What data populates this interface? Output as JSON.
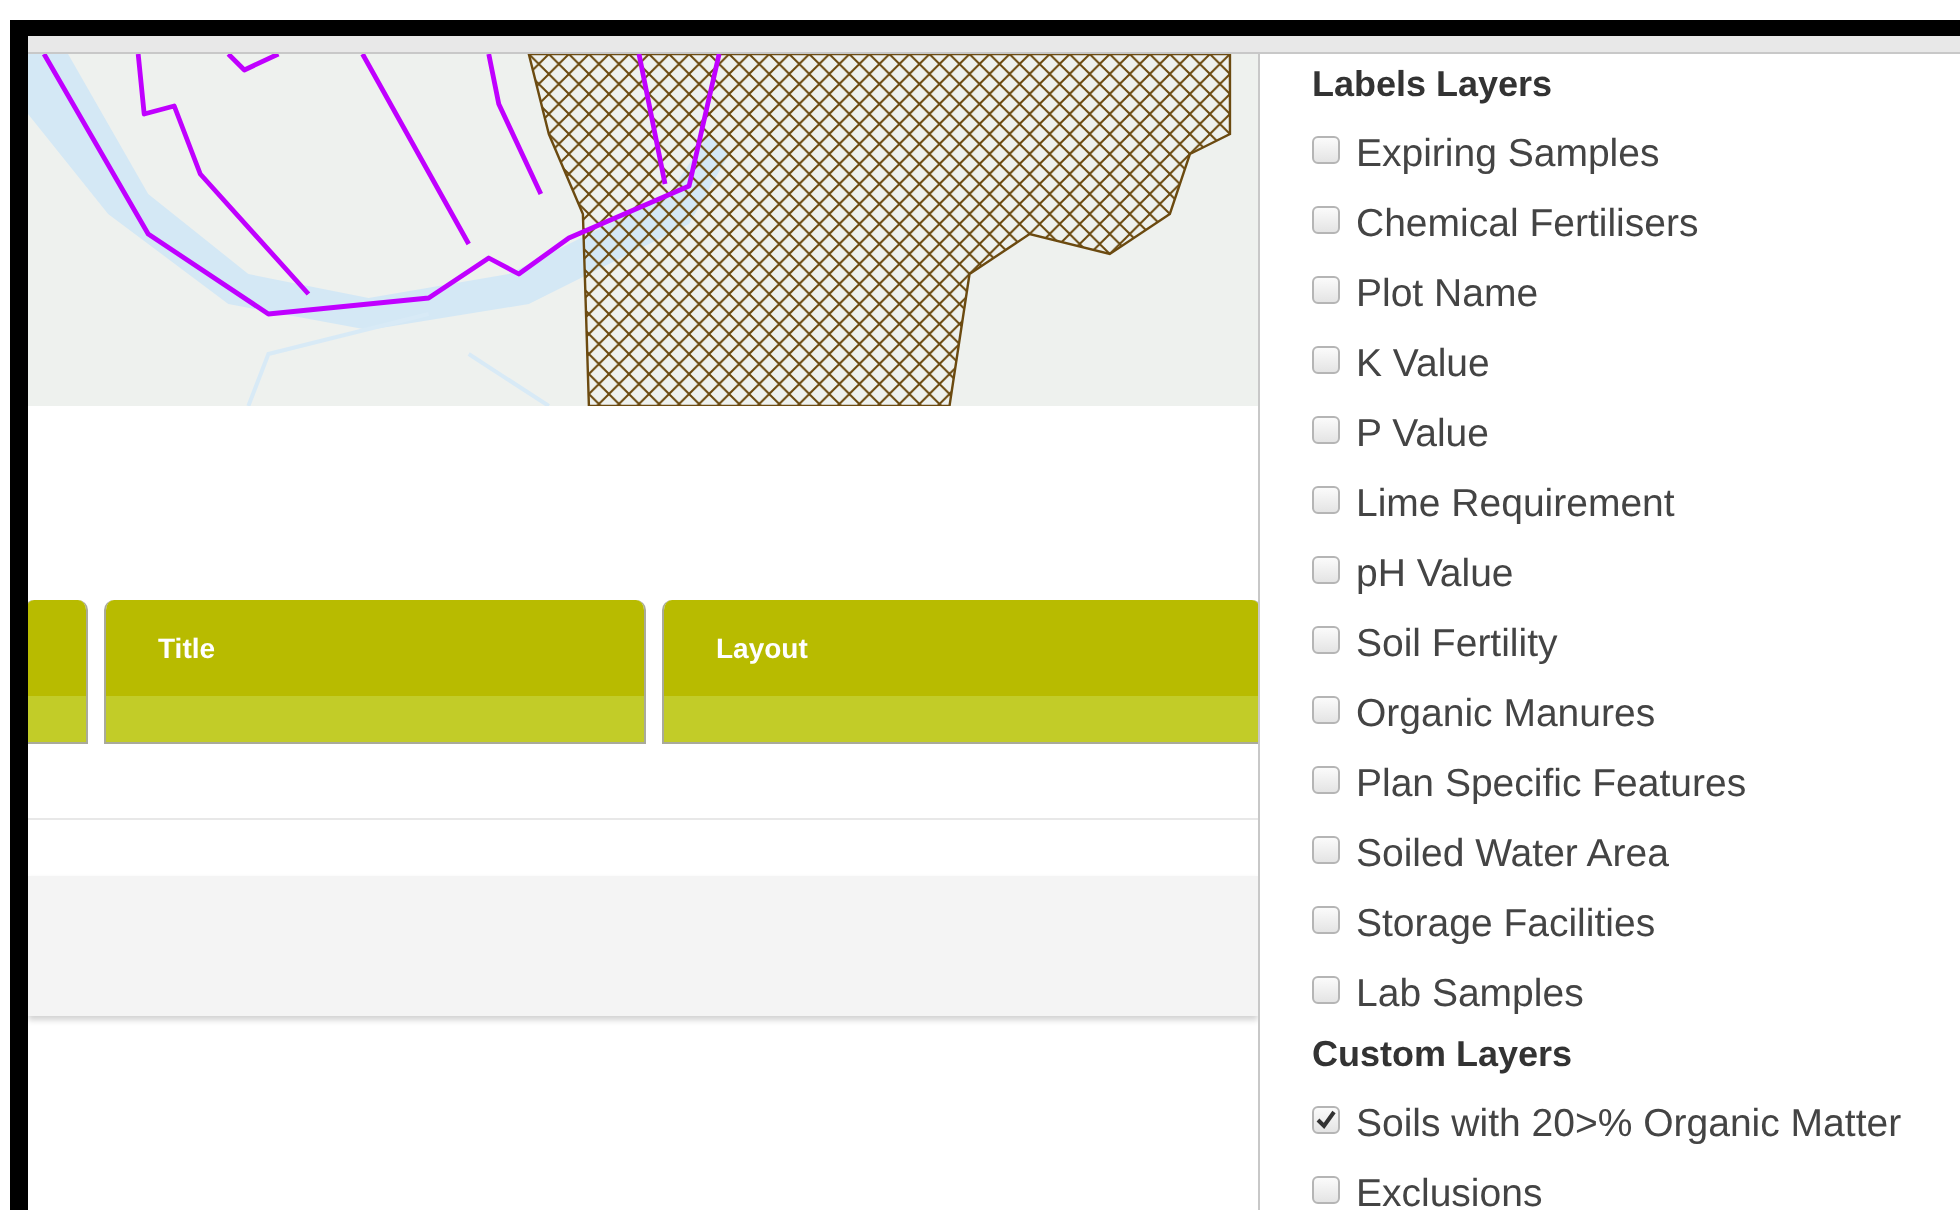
{
  "table": {
    "columns": [
      {
        "label": "Title"
      },
      {
        "label": "Layout"
      }
    ]
  },
  "layer_groups": [
    {
      "title": "Labels Layers",
      "layers": [
        {
          "label": "Expiring Samples",
          "checked": false
        },
        {
          "label": "Chemical Fertilisers",
          "checked": false
        },
        {
          "label": "Plot Name",
          "checked": false
        },
        {
          "label": "K Value",
          "checked": false
        },
        {
          "label": "P Value",
          "checked": false
        },
        {
          "label": "Lime Requirement",
          "checked": false
        },
        {
          "label": "pH Value",
          "checked": false
        },
        {
          "label": "Soil Fertility",
          "checked": false
        },
        {
          "label": "Organic Manures",
          "checked": false
        },
        {
          "label": "Plan Specific Features",
          "checked": false
        },
        {
          "label": "Soiled Water Area",
          "checked": false
        },
        {
          "label": "Storage Facilities",
          "checked": false
        },
        {
          "label": "Lab Samples",
          "checked": false
        }
      ]
    },
    {
      "title": "Custom Layers",
      "layers": [
        {
          "label": "Soils with 20>% Organic Matter",
          "checked": true
        },
        {
          "label": "Exclusions",
          "checked": false
        }
      ]
    }
  ]
}
